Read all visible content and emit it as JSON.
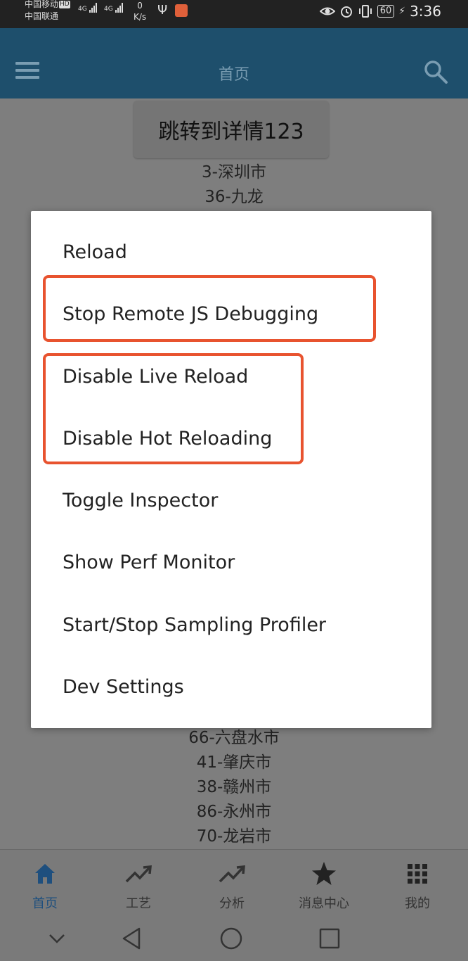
{
  "status_bar": {
    "carrier_1": "中国移动",
    "carrier_1_badge": "HD",
    "carrier_2": "中国联通",
    "network_1": "4G",
    "network_2": "4G",
    "speed_value": "0",
    "speed_unit": "K/s",
    "battery": "60",
    "time": "3:36",
    "icons": [
      "usb-icon",
      "app-notification-icon",
      "eye-icon",
      "alarm-icon",
      "vibrate-icon",
      "battery-icon",
      "charging-icon"
    ]
  },
  "app_bar": {
    "title": "首页",
    "icons": [
      "menu-icon",
      "search-icon"
    ]
  },
  "content": {
    "jump_button_label": "跳转到详情123",
    "cities_top": [
      "3-深圳市",
      "36-九龙"
    ],
    "cities_bottom": [
      "66-六盘水市",
      "41-肇庆市",
      "38-赣州市",
      "86-永州市",
      "70-龙岩市"
    ]
  },
  "dev_menu": {
    "items": [
      "Reload",
      "Stop Remote JS Debugging",
      "Disable Live Reload",
      "Disable Hot Reloading",
      "Toggle Inspector",
      "Show Perf Monitor",
      "Start/Stop Sampling Profiler",
      "Dev Settings"
    ],
    "highlight_color": "#e8532f"
  },
  "tab_bar": {
    "active_color": "#1e4f7e",
    "tabs": [
      {
        "label": "首页",
        "icon": "home-icon",
        "active": true
      },
      {
        "label": "工艺",
        "icon": "trending-up-icon",
        "active": false
      },
      {
        "label": "分析",
        "icon": "trending-up-icon",
        "active": false
      },
      {
        "label": "消息中心",
        "icon": "star-icon",
        "active": false
      },
      {
        "label": "我的",
        "icon": "grid-icon",
        "active": false
      }
    ]
  },
  "nav_bar": {
    "icons": [
      "collapse-chevron-icon",
      "back-icon",
      "home-circle-icon",
      "recents-icon"
    ]
  },
  "colors": {
    "app_bar": "#1e4f6c",
    "overlay_background": "#7e7e7e",
    "dialog_background": "#ffffff"
  }
}
